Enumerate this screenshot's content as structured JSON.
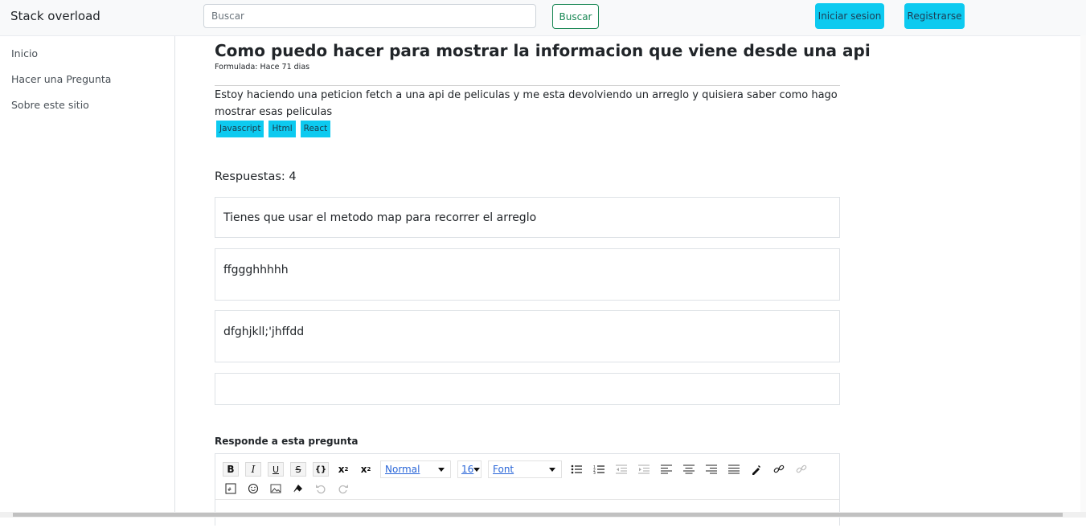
{
  "navbar": {
    "brand": "Stack overload",
    "search_placeholder": "Buscar",
    "search_button": "Buscar",
    "login_button": "Iniciar sesion",
    "register_button": "Registrarse"
  },
  "sidebar": {
    "items": [
      {
        "label": "Inicio"
      },
      {
        "label": "Hacer una Pregunta"
      },
      {
        "label": "Sobre este sitio"
      }
    ]
  },
  "question": {
    "title": "Como puedo hacer para mostrar la informacion que viene desde una api",
    "meta": "Formulada: Hace 71 dias",
    "body": "Estoy haciendo una peticion fetch a una api de peliculas y me esta devolviendo un arreglo y quisiera saber como hago mostrar esas peliculas",
    "tags": [
      "Javascript",
      "Html",
      "React"
    ]
  },
  "answers": {
    "count_label": "Respuestas: 4",
    "items": [
      "Tienes que usar el metodo map para recorrer el arreglo",
      "ffggghhhhh",
      "dfghjkll;'jhffdd",
      ""
    ]
  },
  "reply": {
    "label": "Responde a esta pregunta",
    "toolbar": {
      "format_select": "Normal",
      "size_select": "16",
      "font_select": "Font",
      "icons": [
        "bold-icon",
        "italic-icon",
        "underline-icon",
        "strikethrough-icon",
        "code-icon",
        "superscript-icon",
        "subscript-icon",
        "unordered-list-icon",
        "ordered-list-icon",
        "outdent-icon",
        "indent-icon",
        "align-left-icon",
        "align-center-icon",
        "align-right-icon",
        "align-justify-icon",
        "color-picker-icon",
        "link-icon",
        "unlink-icon",
        "embed-icon",
        "emoji-icon",
        "image-icon",
        "eraser-icon",
        "undo-icon",
        "redo-icon"
      ]
    }
  },
  "colors": {
    "accent_cyan": "#0dcaf0",
    "success_green": "#198754"
  }
}
